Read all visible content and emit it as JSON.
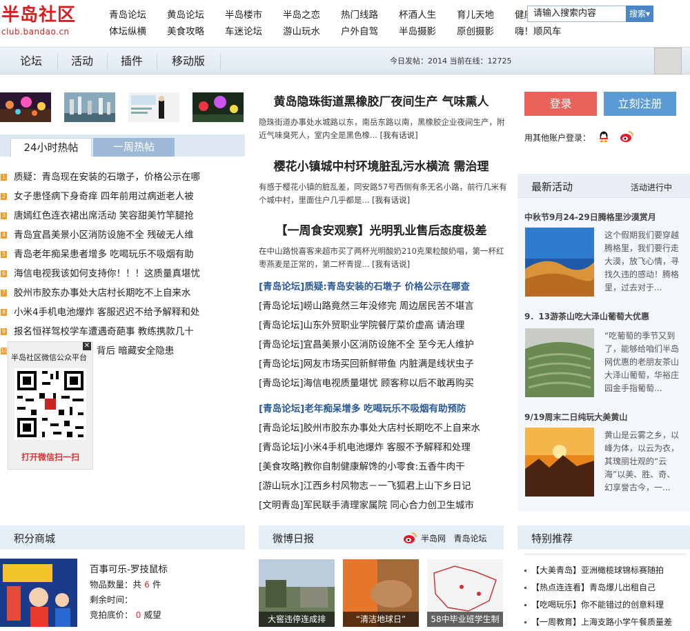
{
  "logo": {
    "name": "半岛社区",
    "url": "club.bandao.cn"
  },
  "top_nav": [
    [
      "青岛论坛",
      "黄岛论坛",
      "半岛楼市",
      "半岛之恋",
      "热门线路",
      "杯酒人生",
      "育儿天地",
      "健康沙龙"
    ],
    [
      "体坛纵横",
      "美食攻略",
      "车迷论坛",
      "游山玩水",
      "户外自驾",
      "半岛摄影",
      "原创摄影",
      "嗨！顺风车"
    ]
  ],
  "nav_bar": {
    "tabs": [
      "论坛",
      "活动",
      "插件",
      "移动版"
    ],
    "stats": "今日发帖：2014  当前在线：12725",
    "search_placeholder": "请输入搜索内容",
    "search_button": "搜索▾"
  },
  "hot": {
    "tab_active": "24小时热帖",
    "tab_inactive": "一周热帖",
    "items": [
      {
        "num": "1",
        "text": "质疑：青岛现在安装的石墩子，价格公示在哪"
      },
      {
        "num": "2",
        "text": "女子患怪病下身奇痒  四年前用过病逝老人被"
      },
      {
        "num": "3",
        "text": "唐嫣红色连衣裙出席活动  笑容甜美竹竿腿抢"
      },
      {
        "num": "4",
        "text": "青岛宜昌美景小区消防设施不全  残破无人维"
      },
      {
        "num": "5",
        "text": "青岛老年痴呆患者增多  吃喝玩乐不吸烟有助"
      },
      {
        "num": "6",
        "text": "海信电视我该如何支持你！！！这质量真堪忧"
      },
      {
        "num": "7",
        "text": "胶州市胶东办事处大店村长期吃不上自来水"
      },
      {
        "num": "8",
        "text": "小米4手机电池爆炸  客服迟迟不给予解释和处"
      },
      {
        "num": "9",
        "text": "报名恒祥驾校学车遭遇奇葩事  教练携款几十"
      },
      {
        "num": "10",
        "text": "背后  暗藏安全隐患"
      }
    ]
  },
  "wechat": {
    "title": "半岛社区微信公众平台",
    "open": "打开微信扫一扫",
    "close": "✕"
  },
  "center": {
    "headlines": [
      {
        "title": "黄岛隐珠街道黑橡胶厂夜间生产  气味熏人",
        "summary": "隐珠街道办事处水城路以东，南岳东路以南，黑橡胶企业夜间生产，附近气味臭死人，室内全是黑色橡...",
        "more": "[我有话说]"
      },
      {
        "title": "樱花小镇城中村环境脏乱污水横流  需治理",
        "summary": "有感于樱花小镇的脏乱差，同安路57号西侧有条无名小路，前行几米有个城中村，里面住户几乎都是...",
        "more": "[我有话说]"
      },
      {
        "title": "【一周食安观察】光明乳业售后态度极差",
        "summary": "在中山路悦喜客来超市买了两杯光明酸奶210克果粒酸奶唱，第一杯红枣燕麦是正常的，第二杯青提...",
        "more": "[我有话说]"
      }
    ],
    "list1": [
      {
        "text": "[青岛论坛]质疑:青岛安装的石墩子  价格公示在哪查",
        "featured": true
      },
      {
        "text": "[青岛论坛]崂山路竟然三年没修完  周边居民苦不堪言"
      },
      {
        "text": "[青岛论坛]山东外贸职业学院餐厅菜价虚高  请治理"
      },
      {
        "text": "[青岛论坛]宜昌美景小区消防设施不全  至今无人维护"
      },
      {
        "text": "[青岛论坛]网友市场买回新鲜带鱼  内脏满是线状虫子"
      },
      {
        "text": "[青岛论坛]海信电视质量堪忧  顾客称以后不敢再购买"
      }
    ],
    "list2": [
      {
        "text": "[青岛论坛]老年痴呆增多  吃喝玩乐不吸烟有助预防",
        "featured": true
      },
      {
        "text": "[青岛论坛]胶州市胶东办事处大店村长期吃不上自来水"
      },
      {
        "text": "[青岛论坛]小米4手机电池爆炸  客服不予解释和处理"
      },
      {
        "text": "[美食攻略]教你自制健康解馋的小零食:五香牛肉干"
      },
      {
        "text": "[游山玩水]江西乡村风物志－一飞狐君上山下乡日记"
      },
      {
        "text": "[文明青岛]军民联手清理家属院  同心合力创卫生城市"
      }
    ]
  },
  "account": {
    "login": "登录",
    "register": "立刻注册",
    "other": "用其他账户登录："
  },
  "activities": {
    "title": "最新活动",
    "status": "活动进行中",
    "items": [
      {
        "title": "中秋节9月24-29日腾格里沙漠赏月",
        "desc": "这个假期我们要穿越腾格里，我们要行走大漠，放飞心情，寻找久违的感动！腾格里，过去对于..."
      },
      {
        "title": "9．13游茶山吃大泽山葡萄大优惠",
        "desc": "“吃葡萄的季节又到了，能够给咱们半岛网优惠的老朋友茶山大泽山葡萄，华裕庄园金手指葡萄..."
      },
      {
        "title": "9/19周末二日纯玩大美黄山",
        "desc": "黄山是云雾之乡，以峰为体，以云为衣，其瑰丽壮观的“云海”以美、胜、奇、幻享誉古今，一..."
      }
    ]
  },
  "shop": {
    "title": "积分商城",
    "item_title": "百事可乐-罗技鼠标",
    "qty_label": "物品数量：共",
    "qty_value": "6",
    "qty_unit": "件",
    "remain": "剩余时间：",
    "bid_label": "竞拍底价：",
    "bid_value": "0",
    "bid_unit": "威望"
  },
  "weibo": {
    "title": "微博日报",
    "links": [
      "半岛网",
      "青岛论坛"
    ],
    "captions": [
      "大窖违停连成排",
      "“清洁地球日”",
      "58中毕业班学生制"
    ]
  },
  "recommend": {
    "title": "特别推荐",
    "items": [
      "【大美青岛】亚洲橄榄球锦标赛随拍",
      "【热点连连看】青岛爆儿出租自己",
      "【吃喝玩乐】你不能错过的创意料理",
      "【一周教育】上海支路小学午餐质量差"
    ]
  },
  "colors": {
    "accent_blue": "#5b9bd5",
    "login_red": "#e8625a",
    "brand_red": "#d71f1f",
    "featured_blue": "#2a5a9a"
  }
}
